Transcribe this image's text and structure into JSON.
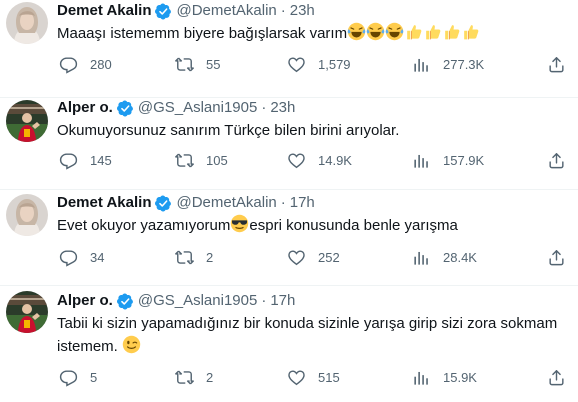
{
  "tweets": [
    {
      "name": "Demet Akalin",
      "verified": true,
      "handle": "@DemetAkalin",
      "separator": "·",
      "time": "23h",
      "text": "Maaaşı istememm biyere bağışlarsak varım",
      "emojis": [
        "face-with-tears-of-joy",
        "face-with-tears-of-joy",
        "face-with-tears-of-joy",
        "thumbs-up",
        "thumbs-up",
        "thumbs-up",
        "thumbs-up"
      ],
      "replies": "280",
      "retweets": "55",
      "likes": "1,579",
      "views": "277.3K"
    },
    {
      "name": "Alper o.",
      "verified": true,
      "handle": "@GS_Aslani1905",
      "separator": "·",
      "time": "23h",
      "text": "Okumuyorsunuz sanırım Türkçe bilen birini arıyolar.",
      "replies": "145",
      "retweets": "105",
      "likes": "14.9K",
      "views": "157.9K"
    },
    {
      "name": "Demet Akalin",
      "verified": true,
      "handle": "@DemetAkalin",
      "separator": "·",
      "time": "17h",
      "text_before": "Evet okuyor yazamıyorum",
      "text_after": "espri konusunda benle yarışma",
      "emojis": [
        "smiling-face-with-sunglasses"
      ],
      "replies": "34",
      "retweets": "2",
      "likes": "252",
      "views": "28.4K"
    },
    {
      "name": "Alper o.",
      "verified": true,
      "handle": "@GS_Aslani1905",
      "separator": "·",
      "time": "17h",
      "text_line1": "Tabii ki sizin yapamadığınız bir konuda sizinle yarışa girip sizi zora sokmam",
      "text_line2": "istemem.",
      "emojis": [
        "winking-face"
      ],
      "replies": "5",
      "retweets": "2",
      "likes": "515",
      "views": "15.9K"
    }
  ],
  "icons": {
    "reply": "reply-icon",
    "retweet": "retweet-icon",
    "like": "like-icon",
    "views": "views-icon",
    "share": "share-icon",
    "verified": "verified-badge-icon"
  },
  "colors": {
    "verified_blue": "#1d9bf0",
    "secondary_text": "#536471",
    "primary_text": "#0f1419",
    "divider": "#eff3f4"
  }
}
